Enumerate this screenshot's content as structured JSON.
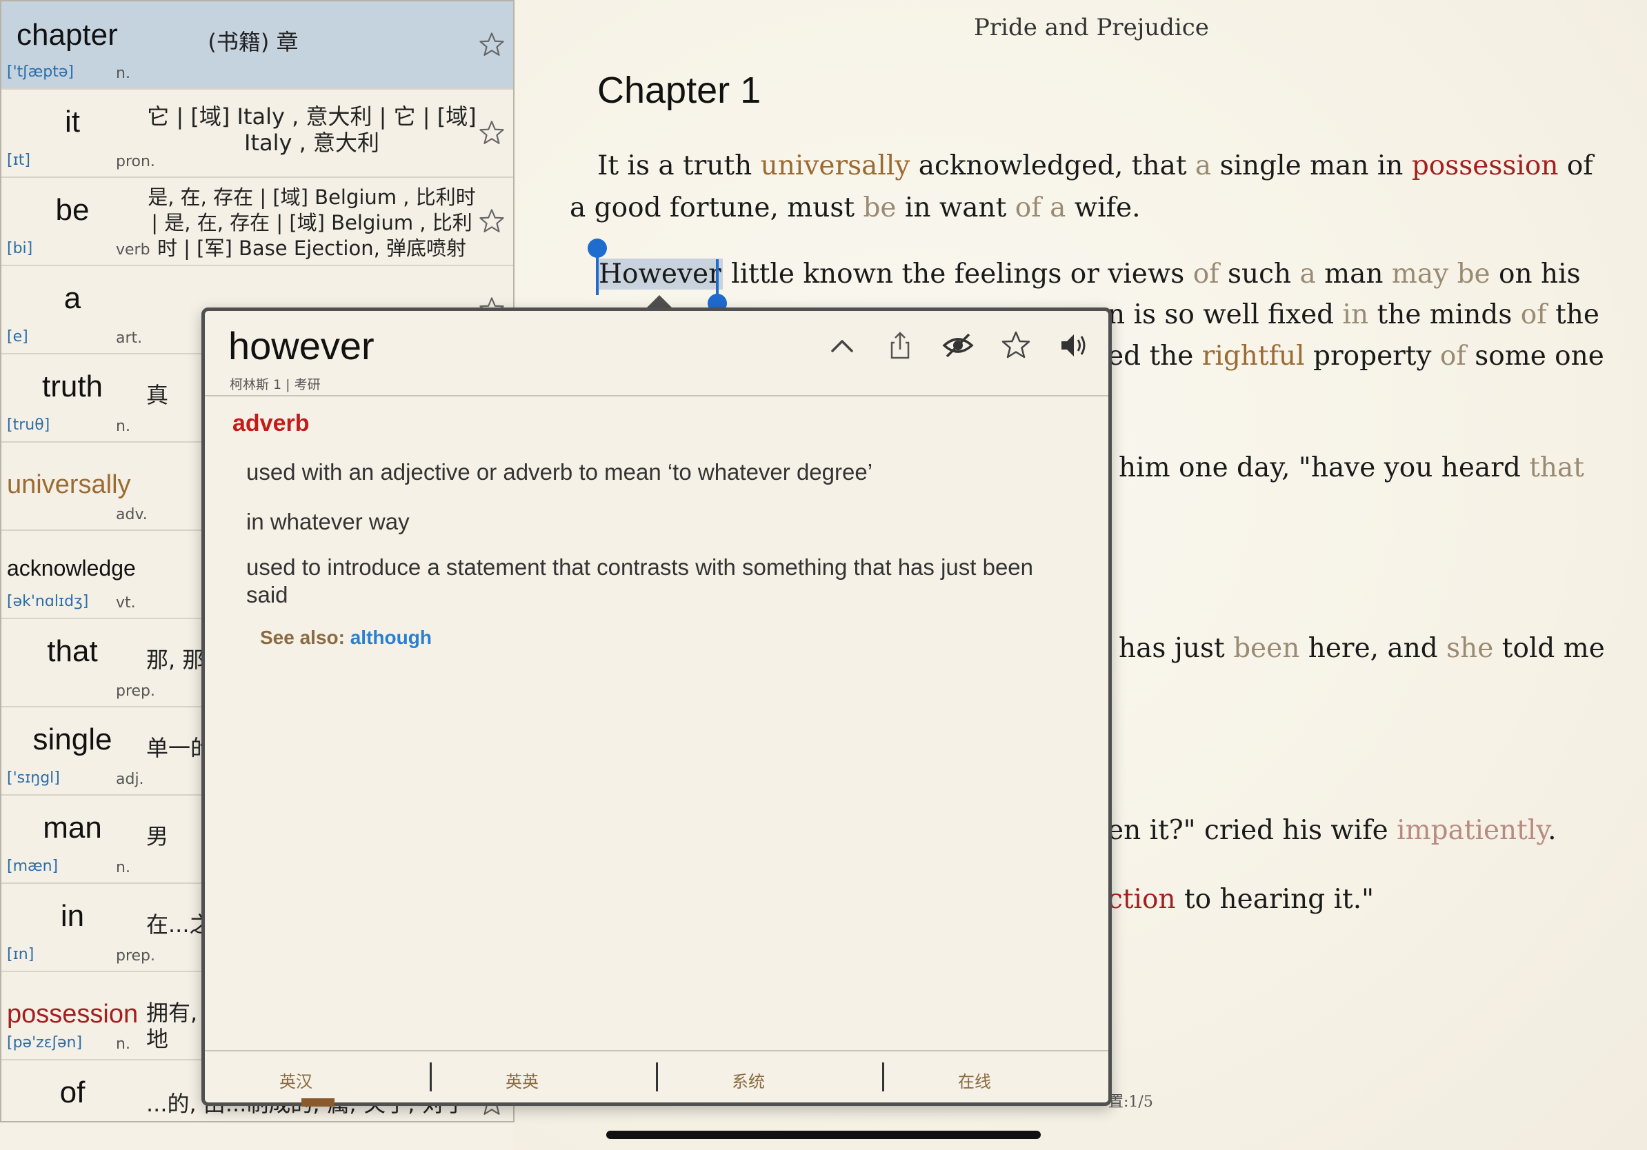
{
  "book": {
    "title": "Pride and Prejudice",
    "chapter": "Chapter 1",
    "progress": "置:1/5"
  },
  "text": {
    "p1_parts": [
      "It is a truth ",
      "universally",
      " acknowledged, that ",
      "a",
      " single man in ",
      "possession",
      " of a good fortune, must ",
      "be",
      " in want ",
      "of",
      " ",
      "a",
      " wife."
    ],
    "l_however_sel": "However",
    "l_however_rest_parts": [
      " little known the feelings or views ",
      "of",
      " such ",
      "a",
      " man ",
      "may",
      " ",
      "be",
      " on his"
    ],
    "l2_parts": [
      "n is so well fixed ",
      "in",
      " the minds ",
      "of",
      " the"
    ],
    "l3_parts": [
      "ed the ",
      "rightful",
      " property ",
      "of",
      " some one"
    ],
    "l4_parts": [
      "him one day, \"have you heard ",
      "that"
    ],
    "l5_parts": [
      "has just ",
      "been",
      " here, and ",
      "she",
      " told me"
    ],
    "l6_parts": [
      "en it?\" cried his wife ",
      "impatiently",
      "."
    ],
    "l7_parts": [
      "ction",
      " to hearing it.\""
    ]
  },
  "word_list": [
    {
      "word": "chapter",
      "phonetic": "['tʃæptə]",
      "pos": "n.",
      "definition": "(书籍) 章",
      "active": true
    },
    {
      "word": "it",
      "phonetic": "[ɪt]",
      "pos": "pron.",
      "definition": "它 | [域] Italy , 意大利 | 它 | [域]\nItaly , 意大利"
    },
    {
      "word": "be",
      "phonetic": "[bi]",
      "pos": "verb",
      "definition": "是, 在, 存在 | [域] Belgium , 比利时\n| 是, 在, 存在 | [域] Belgium , 比利\n时 | [军] Base Ejection, 弹底喷射"
    },
    {
      "word": "a",
      "phonetic": "[e]",
      "pos": "art.",
      "definition": ""
    },
    {
      "word": "truth",
      "phonetic": "[truθ]",
      "pos": "n.",
      "definition": "真"
    },
    {
      "word": "universally",
      "phonetic": "",
      "pos": "adv.",
      "definition": ""
    },
    {
      "word": "acknowledge",
      "phonetic": "[ək'nɑlɪdʒ]",
      "pos": "vt.",
      "definition": ""
    },
    {
      "word": "that",
      "phonetic": "",
      "pos": "prep.",
      "definition": "那, 那"
    },
    {
      "word": "single",
      "phonetic": "['sɪŋgl]",
      "pos": "adj.",
      "definition": "单一的"
    },
    {
      "word": "man",
      "phonetic": "[mæn]",
      "pos": "n.",
      "definition": "男"
    },
    {
      "word": "in",
      "phonetic": "[ɪn]",
      "pos": "prep.",
      "definition": "在...之"
    },
    {
      "word": "possession",
      "phonetic": "[pə'zɛʃən]",
      "pos": "n.",
      "definition": "拥有,\n地"
    },
    {
      "word": "of",
      "phonetic": "",
      "pos": "",
      "definition": "...的, 由...制成的; 属; 关于; 对于"
    }
  ],
  "popup": {
    "word": "however",
    "tags": "柯林斯 1 | 考研",
    "pos": "adverb",
    "senses": [
      "used with an adjective or adverb to mean ‘to whatever degree’",
      "in whatever way",
      "used to introduce a statement that contrasts with something that has just been said"
    ],
    "see_also_label": "See also: ",
    "see_also_link": "although",
    "tabs": [
      "英汉",
      "英英",
      "系统",
      "在线"
    ],
    "tools": [
      "chevron-up-icon",
      "share-icon",
      "hide-eye-icon",
      "star-icon",
      "speaker-icon"
    ]
  },
  "colors": {
    "highlight_brown": "#9b6b33",
    "highlight_red": "#a32020",
    "highlight_pink": "#b88a82",
    "link_blue": "#2a7fd0",
    "pos_red": "#c41a1a",
    "phonetic_blue": "#2c6da8"
  }
}
